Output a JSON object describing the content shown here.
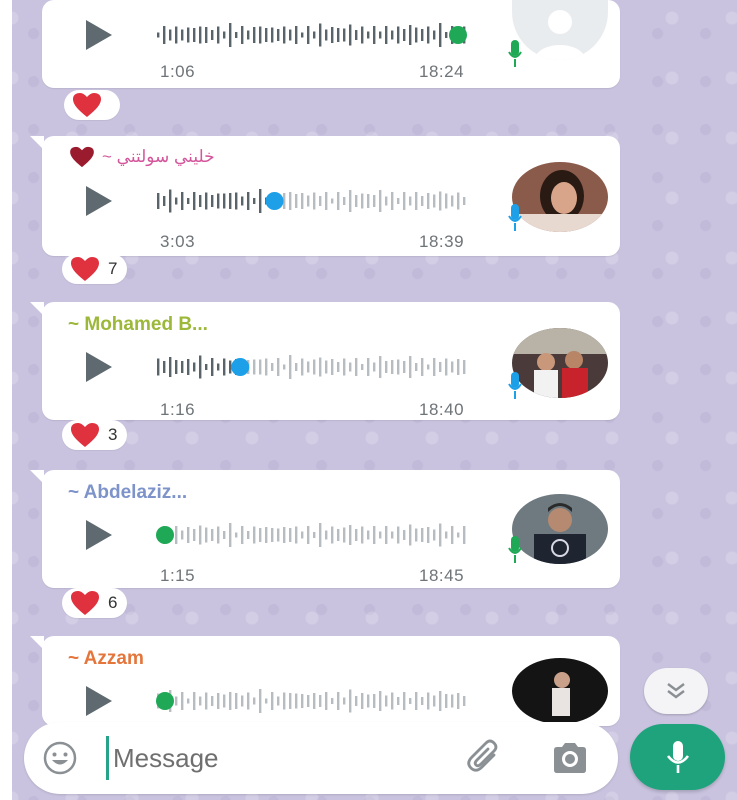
{
  "messages": [
    {
      "sender": "",
      "duration": "1:06",
      "time": "18:24",
      "played_fraction": 1.0,
      "played_color": "#1fa856",
      "avatar": "default-avatar-icon",
      "mic_color": "#1fa856",
      "reaction": {
        "emoji": "heart",
        "count": ""
      }
    },
    {
      "sender": "~ خليني سولتني",
      "sender_color": "#d3559a",
      "sender_prefix_emoji": "heart",
      "duration": "3:03",
      "time": "18:39",
      "played_fraction": 0.38,
      "played_color": "#1ea0e8",
      "avatar": "photo-avatar",
      "mic_color": "#1ea0e8",
      "reaction": {
        "emoji": "heart",
        "count": "7"
      }
    },
    {
      "sender": "~ Mohamed B...",
      "sender_color": "#9cb83a",
      "duration": "1:16",
      "time": "18:40",
      "played_fraction": 0.27,
      "played_color": "#1ea0e8",
      "avatar": "photo-avatar",
      "mic_color": "#1ea0e8",
      "reaction": {
        "emoji": "heart",
        "count": "3"
      }
    },
    {
      "sender": "~ Abdelaziz...",
      "sender_color": "#7d93c9",
      "duration": "1:15",
      "time": "18:45",
      "played_fraction": 0.0,
      "played_color": "#1fa856",
      "avatar": "photo-avatar",
      "mic_color": "#1fa856",
      "reaction": {
        "emoji": "heart",
        "count": "6"
      }
    },
    {
      "sender": "~ Azzam",
      "sender_color": "#e4753b",
      "duration": "",
      "time": "",
      "played_fraction": 0.0,
      "played_color": "#1fa856",
      "avatar": "photo-avatar",
      "mic_color": "#1fa856"
    }
  ],
  "composer": {
    "placeholder": "Message",
    "emoji_icon": "emoji-icon",
    "attach_icon": "paperclip-icon",
    "camera_icon": "camera-icon",
    "send_icon": "microphone-icon"
  },
  "scroll_down_icon": "double-chevron-down-icon",
  "colors": {
    "wallpaper": "#c9c3df",
    "bubble": "#ffffff",
    "fab": "#1fa37d",
    "heart": "#e0313f"
  }
}
